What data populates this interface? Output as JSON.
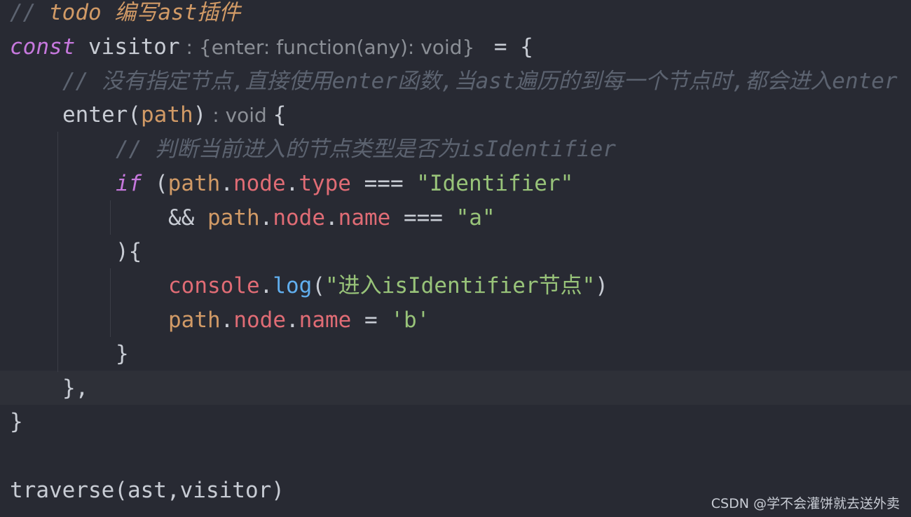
{
  "editor": {
    "lines": {
      "l1": {
        "comment_prefix": "// ",
        "todo": "todo 编写ast插件"
      },
      "l2": {
        "kw": "const",
        "name": " visitor",
        "hint": " : {enter: function(any): void} ",
        "assign": " = {"
      },
      "l3": {
        "comment": "// 没有指定节点,直接使用enter函数,当ast遍历的到每一个节点时,都会进入enter"
      },
      "l4": {
        "method": "enter",
        "open": "(",
        "param": "path",
        "close": ")",
        "hint": " : void ",
        "brace": "{"
      },
      "l5": {
        "comment": "// 判断当前进入的节点类型是否为isIdentifier"
      },
      "l6": {
        "kw": "if",
        "open": " (",
        "obj": "path",
        "dot1": ".",
        "prop1": "node",
        "dot2": ".",
        "prop2": "type",
        "op": " === ",
        "str": "\"Identifier\""
      },
      "l7": {
        "and": "&& ",
        "obj": "path",
        "dot1": ".",
        "prop1": "node",
        "dot2": ".",
        "prop2": "name",
        "op": " === ",
        "str": "\"a\""
      },
      "l8": {
        "text": "){"
      },
      "l9": {
        "obj": "console",
        "dot": ".",
        "fn": "log",
        "open": "(",
        "str": "\"进入isIdentifier节点\"",
        "close": ")"
      },
      "l10": {
        "obj": "path",
        "dot1": ".",
        "prop1": "node",
        "dot2": ".",
        "prop2": "name",
        "op": " = ",
        "str": "'b'"
      },
      "l11": {
        "text": "}"
      },
      "l12": {
        "text": "},"
      },
      "l13": {
        "text": "}"
      },
      "l15": {
        "text": "traverse(ast,visitor)"
      }
    },
    "colors": {
      "background": "#282a33",
      "keyword": "#c678dd",
      "comment": "#5c6370",
      "todo": "#d19a66",
      "property": "#e06c75",
      "string": "#98c379",
      "function": "#61afef"
    }
  },
  "watermark": "CSDN @学不会灌饼就去送外卖"
}
